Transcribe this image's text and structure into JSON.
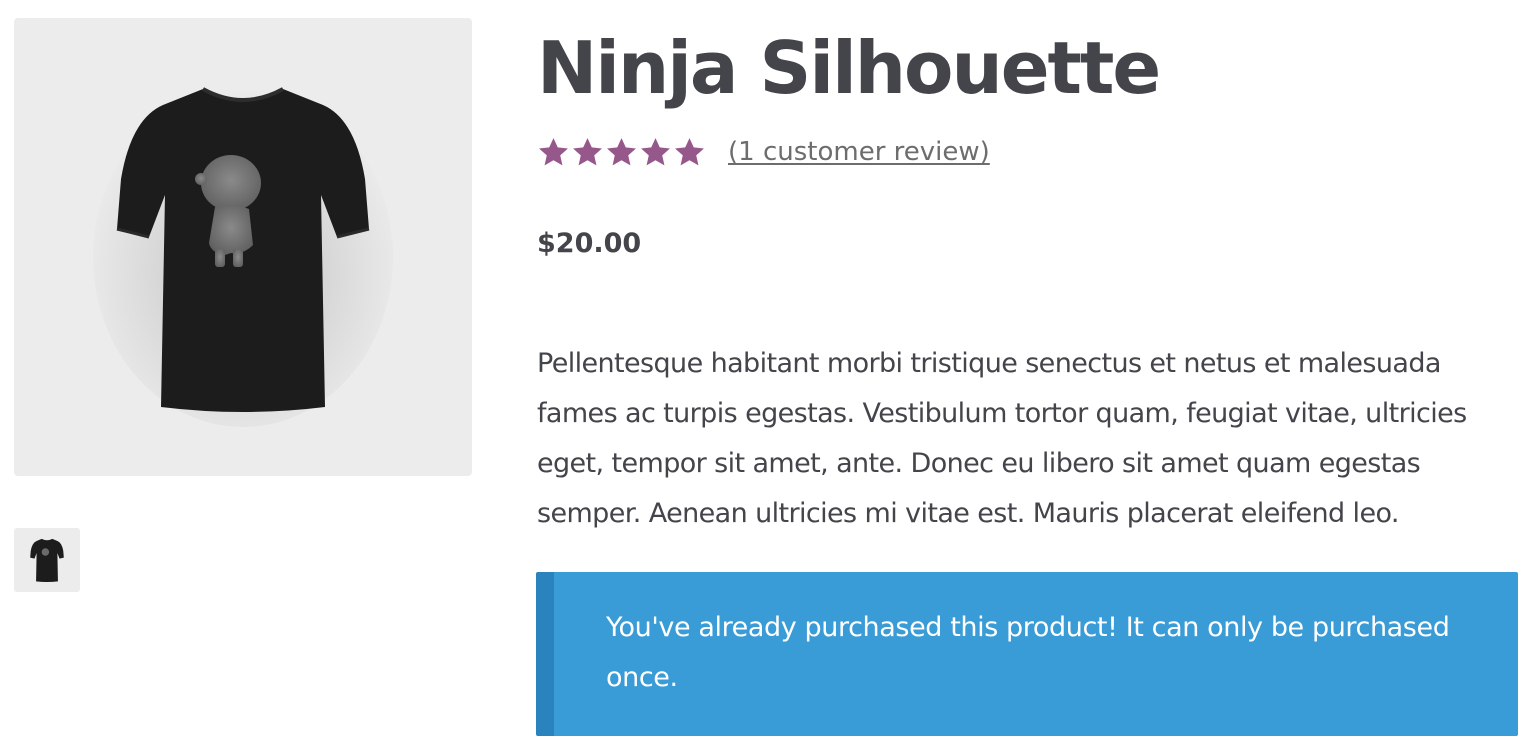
{
  "product": {
    "title": "Ninja Silhouette",
    "rating": 5,
    "rating_max": 5,
    "review_link": "(1 customer review)",
    "price": "$20.00",
    "description": "Pellentesque habitant morbi tristique senectus et netus et malesuada fames ac turpis egestas. Vestibulum tortor quam, feugiat vitae, ultricies eget, tempor sit amet, ante. Donec eu libero sit amet quam egestas semper. Aenean ultricies mi vitae est. Mauris placerat eleifend leo."
  },
  "notice": {
    "text": "You've already purchased this product! It can only be purchased once."
  },
  "colors": {
    "star": "#96588a",
    "notice_bg": "#3a9cd6",
    "notice_border": "#2b83bd",
    "text": "#43454b"
  },
  "icons": {
    "star": "star-icon",
    "product_image": "tshirt-image",
    "thumbnail": "tshirt-thumbnail"
  }
}
